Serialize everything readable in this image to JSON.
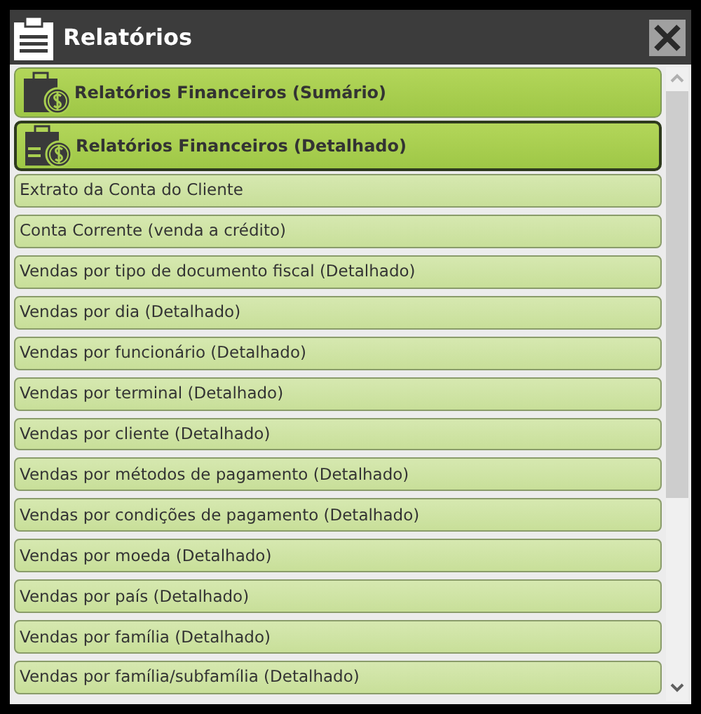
{
  "window": {
    "title": "Relatórios"
  },
  "items": [
    {
      "kind": "header",
      "label": "Relatórios Financeiros (Sumário)",
      "selected": false
    },
    {
      "kind": "header",
      "label": "Relatórios Financeiros (Detalhado)",
      "selected": true
    },
    {
      "kind": "report",
      "label": "Extrato da Conta do Cliente",
      "selected": false
    },
    {
      "kind": "report",
      "label": "Conta Corrente (venda a crédito)",
      "selected": false
    },
    {
      "kind": "report",
      "label": "Vendas por tipo de documento fiscal (Detalhado)",
      "selected": false
    },
    {
      "kind": "report",
      "label": "Vendas por dia (Detalhado)",
      "selected": false
    },
    {
      "kind": "report",
      "label": "Vendas por funcionário (Detalhado)",
      "selected": false
    },
    {
      "kind": "report",
      "label": "Vendas por terminal (Detalhado)",
      "selected": false
    },
    {
      "kind": "report",
      "label": "Vendas por cliente (Detalhado)",
      "selected": false
    },
    {
      "kind": "report",
      "label": "Vendas por métodos de pagamento (Detalhado)",
      "selected": false
    },
    {
      "kind": "report",
      "label": "Vendas por condições de pagamento (Detalhado)",
      "selected": false
    },
    {
      "kind": "report",
      "label": "Vendas por moeda (Detalhado)",
      "selected": false
    },
    {
      "kind": "report",
      "label": "Vendas por país (Detalhado)",
      "selected": false
    },
    {
      "kind": "report",
      "label": "Vendas por família (Detalhado)",
      "selected": false
    },
    {
      "kind": "report",
      "label": "Vendas por família/subfamília (Detalhado)",
      "selected": false
    }
  ]
}
